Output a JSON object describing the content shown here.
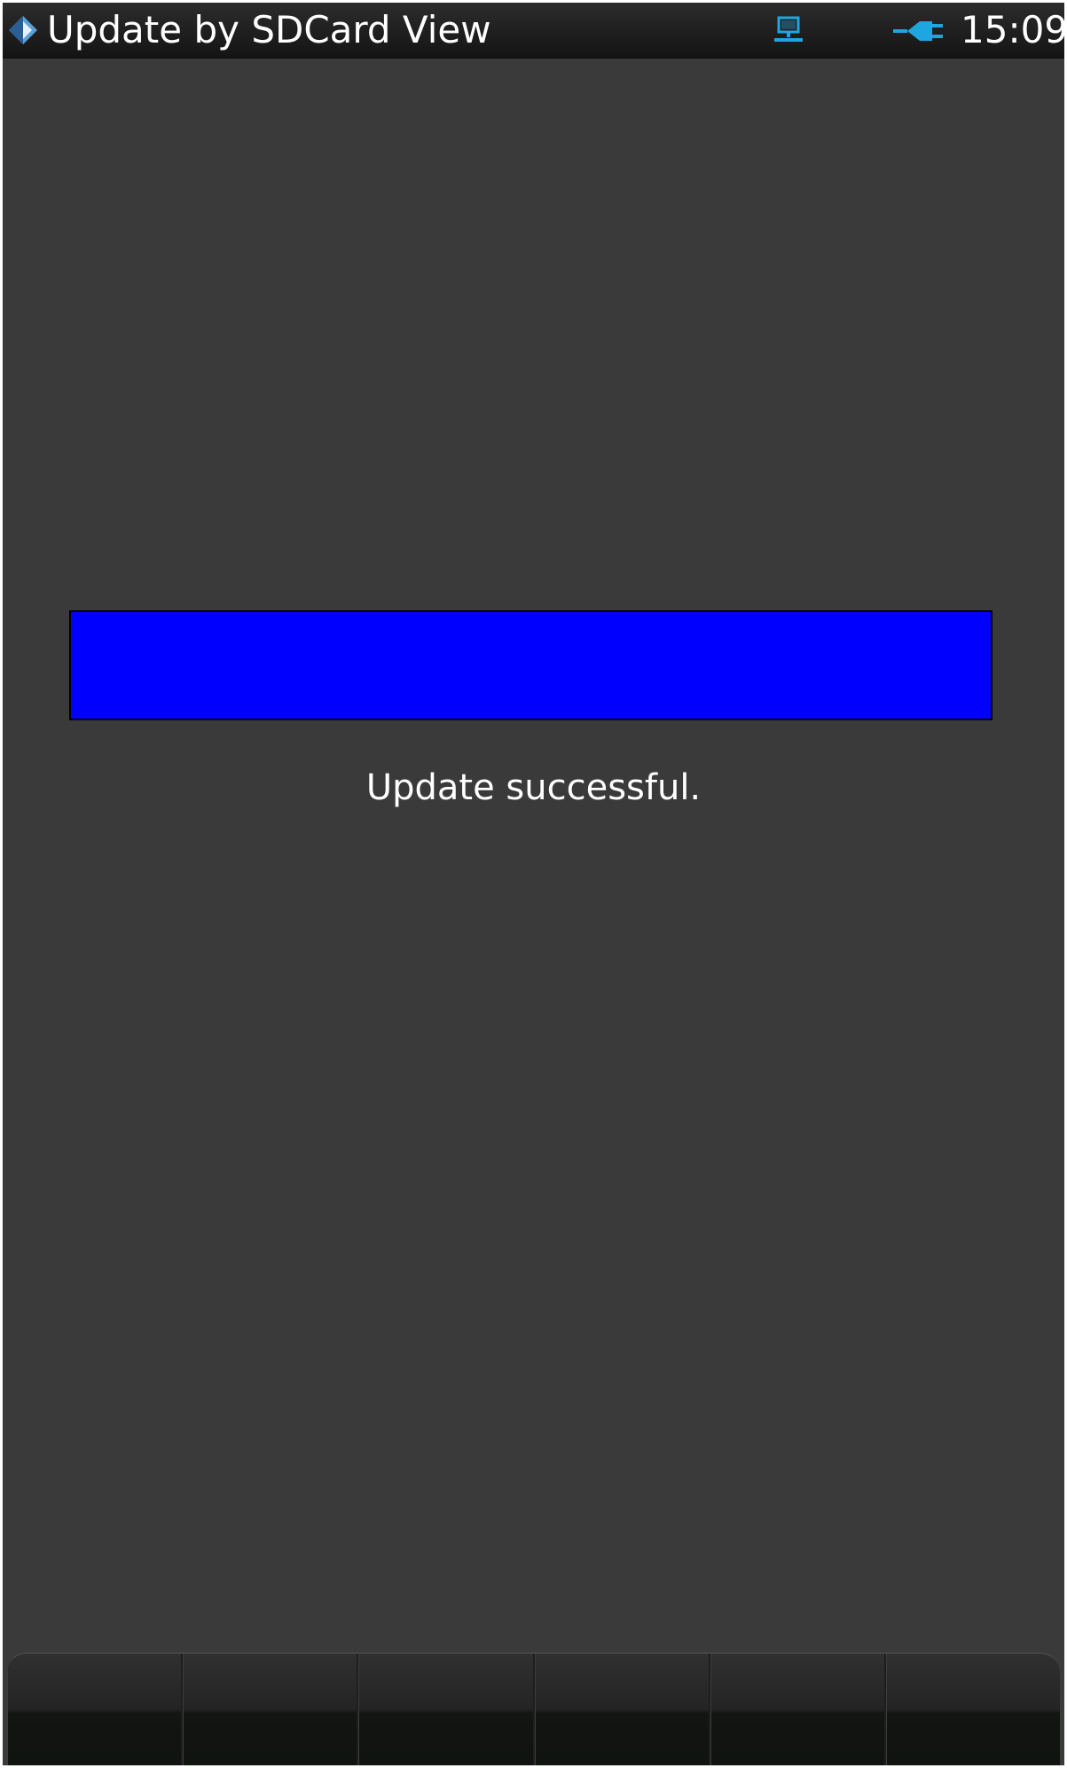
{
  "titlebar": {
    "title": "Update by SDCard View",
    "clock": "15:09",
    "icons": [
      "app-diamond-icon",
      "network-computer-icon",
      "power-plug-icon"
    ],
    "icon_color": "#1ea6e0"
  },
  "progress": {
    "percent": 100,
    "fill_color": "#0000ff",
    "status_text": "Update successful."
  },
  "softkeys": [
    {
      "label": ""
    },
    {
      "label": ""
    },
    {
      "label": ""
    },
    {
      "label": ""
    },
    {
      "label": ""
    },
    {
      "label": ""
    }
  ]
}
